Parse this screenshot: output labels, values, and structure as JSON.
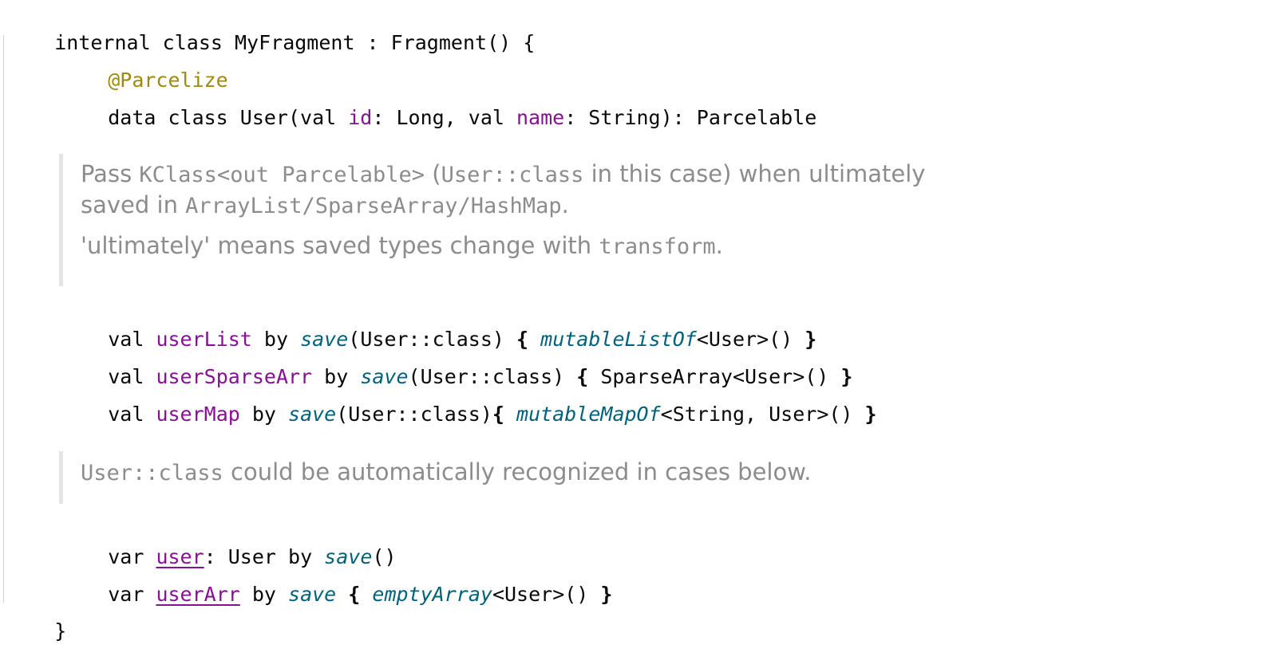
{
  "editor": {
    "line1": {
      "a": "internal class MyFragment : Fragment() {"
    },
    "line2": {
      "annotation": "@Parcelize"
    },
    "line3": {
      "a": "data class User(val ",
      "p1": "id",
      "b": ": Long, val ",
      "p2": "name",
      "c": ": String): Parcelable"
    },
    "doc1": {
      "p1_a": "Pass ",
      "p1_code1": "KClass<out Parcelable>",
      "p1_b": " (",
      "p1_code2": "User::class",
      "p1_c": " in this case) when ultimately",
      "p2_a": "saved in ",
      "p2_code": "ArrayList/SparseArray/HashMap",
      "p2_b": ".",
      "p3_a": "'ultimately' means saved types change with ",
      "p3_code": "transform",
      "p3_b": "."
    },
    "line4": {
      "kw": "val ",
      "prop": "userList",
      "by": " by ",
      "fn": "save",
      "args": "(User::class) ",
      "lb": "{",
      "sp": " ",
      "fn2": "mutableListOf",
      "rest": "<User>() ",
      "rb": "}"
    },
    "line5": {
      "kw": "val ",
      "prop": "userSparseArr",
      "by": " by ",
      "fn": "save",
      "args": "(User::class) ",
      "lb": "{",
      "rest": " SparseArray<User>() ",
      "rb": "}"
    },
    "line6": {
      "kw": "val ",
      "prop": "userMap",
      "by": " by ",
      "fn": "save",
      "args": "(User::class)",
      "lb": "{",
      "sp": " ",
      "fn2": "mutableMapOf",
      "rest": "<String, User>() ",
      "rb": "}"
    },
    "doc2": {
      "code": "User::class",
      "text": " could be automatically recognized in cases below."
    },
    "line7": {
      "kw": "var ",
      "prop": "user",
      "rest": ": User by ",
      "fn": "save",
      "end": "()"
    },
    "line8": {
      "kw": "var ",
      "prop": "userArr",
      "by": " by ",
      "fn": "save",
      "sp": " ",
      "lb": "{",
      "sp2": " ",
      "fn2": "emptyArray",
      "rest": "<User>() ",
      "rb": "}"
    },
    "line9": {
      "a": "}"
    }
  },
  "colors": {
    "keyword": "#080808",
    "annotation": "#9e880d",
    "property": "#871094",
    "function": "#00627a",
    "doc_text": "#8c8c8c",
    "doc_border": "#e4e4e4"
  }
}
